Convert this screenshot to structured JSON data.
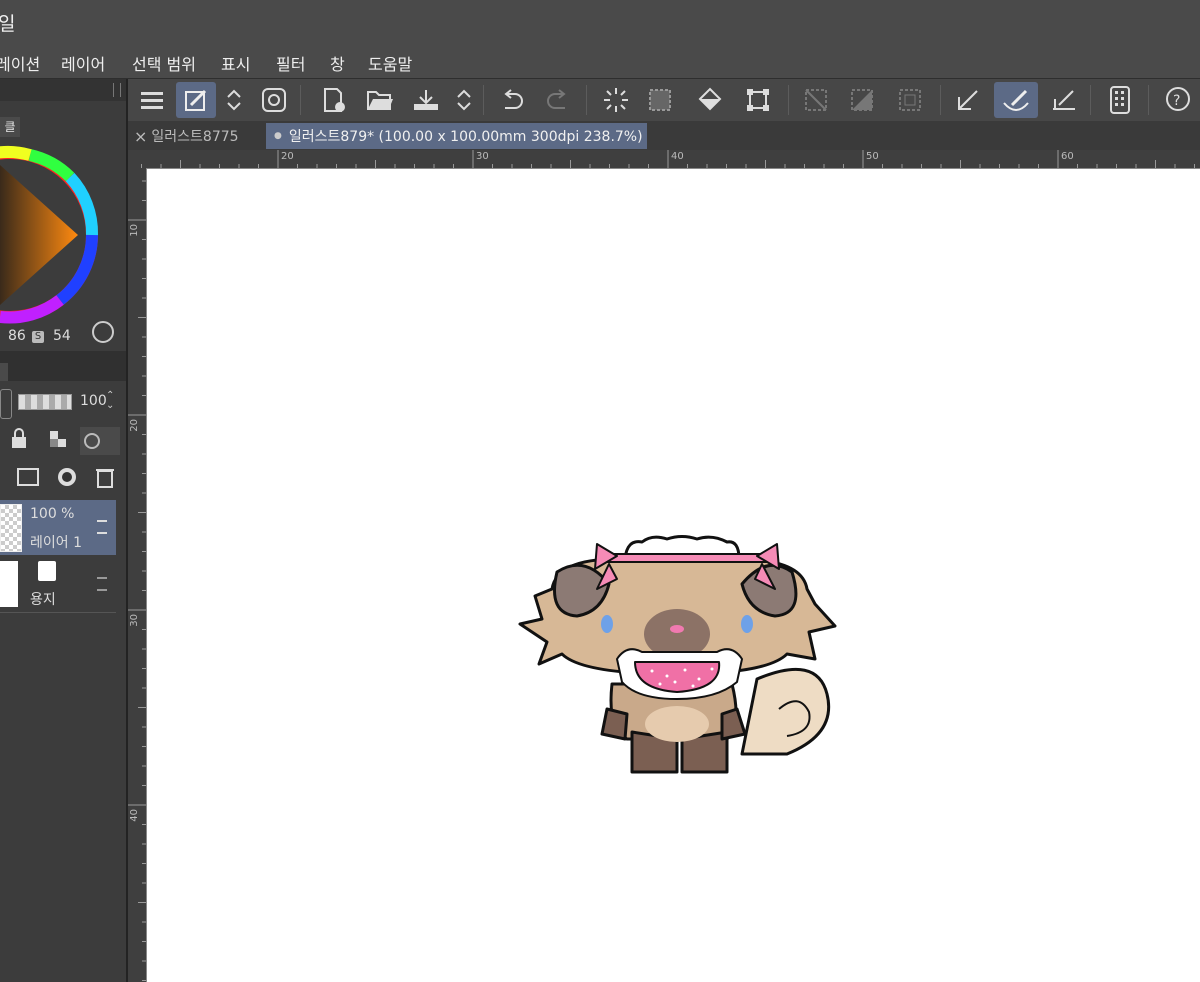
{
  "app": {
    "title_fragment": "일"
  },
  "menu": [
    "레이션",
    "레이어",
    "선택 범위",
    "표시",
    "필터",
    "창",
    "도움말"
  ],
  "color_panel": {
    "tab_label": "클",
    "value_1": "86",
    "s_badge": "S",
    "value_2": "54"
  },
  "layer_panel": {
    "tab_label": "",
    "opacity_value": "100",
    "layers": [
      {
        "opacity": "100 %",
        "name": "레이어 1",
        "selected": true
      },
      {
        "opacity": "",
        "name": "용지",
        "selected": false
      }
    ]
  },
  "tabs": [
    {
      "label": "일러스트8775",
      "active": false,
      "close_glyph": "×"
    },
    {
      "label": "일러스트879* (100.00 x 100.00mm 300dpi 238.7%)",
      "active": true,
      "dot_glyph": "●"
    }
  ],
  "ruler": {
    "top_labels": [
      "20",
      "30",
      "40",
      "50",
      "60"
    ],
    "left_labels": [
      "10",
      "20",
      "30",
      "40"
    ]
  },
  "toolbar_icons": [
    "menu-icon",
    "brush-tool-icon",
    "updown-icon",
    "swirl-icon",
    "new-file-icon",
    "open-folder-icon",
    "save-download-icon",
    "updown-icon",
    "undo-icon",
    "redo-icon",
    "spinner-icon",
    "select-dotted-icon",
    "fill-bucket-icon",
    "transform-icon",
    "deselect-icon",
    "invert-selection-icon",
    "selection-border-icon",
    "pen-angle-icon",
    "brush-stroke-icon",
    "pen-line-icon",
    "device-icon",
    "help-icon"
  ],
  "colors": {
    "accent": "#5c6a86",
    "canvas": "#ffffff",
    "panel": "#3c3c3c"
  }
}
